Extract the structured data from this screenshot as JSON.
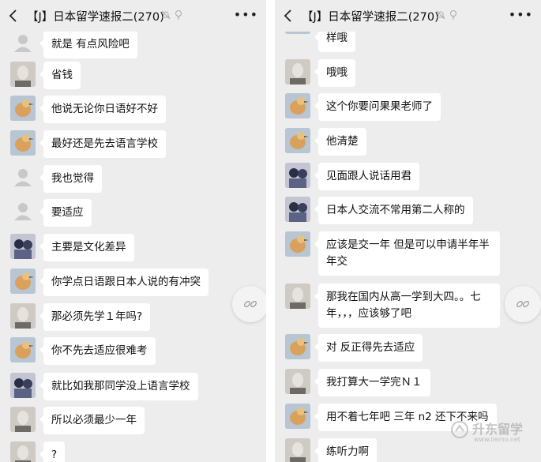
{
  "left": {
    "header": {
      "title": "【J】日本留学速报二(270)"
    },
    "messages": [
      {
        "avatar": "default-avatar",
        "text": "就是 有点风险吧"
      },
      {
        "avatar": "face-avatar",
        "text": "省钱"
      },
      {
        "avatar": "bird-avatar",
        "text": "他说无论你日语好不好"
      },
      {
        "avatar": "bird-avatar",
        "text": "最好还是先去语言学校"
      },
      {
        "avatar": "default-avatar",
        "text": "我也觉得"
      },
      {
        "avatar": "default-avatar",
        "text": "要适应"
      },
      {
        "avatar": "girl-avatar",
        "text": "主要是文化差异"
      },
      {
        "avatar": "bird-avatar",
        "text": "你学点日语跟日本人说的有冲突"
      },
      {
        "avatar": "face-avatar",
        "text": "那必须先学１年吗?"
      },
      {
        "avatar": "bird-avatar",
        "text": "你不先去适应很难考"
      },
      {
        "avatar": "girl-avatar",
        "text": "就比如我那同学没上语言学校"
      },
      {
        "avatar": "face-avatar",
        "text": "所以必须最少一年"
      },
      {
        "avatar": "face-avatar",
        "text": "?"
      }
    ]
  },
  "right": {
    "header": {
      "title": "【J】日本留学速报二(270)"
    },
    "messages": [
      {
        "avatar": "bird-avatar",
        "text": "样哦"
      },
      {
        "avatar": "face-avatar",
        "text": "哦哦"
      },
      {
        "avatar": "bird-avatar",
        "text": "这个你要问果果老师了"
      },
      {
        "avatar": "bird-avatar",
        "text": "他清楚"
      },
      {
        "avatar": "girl-avatar",
        "text": "见面跟人说话用君"
      },
      {
        "avatar": "girl-avatar",
        "text": "日本人交流不常用第二人称的"
      },
      {
        "avatar": "bird-avatar",
        "text": "应该是交一年 但是可以申请半年半年交"
      },
      {
        "avatar": "face-avatar",
        "text": "那我在国内从高一学到大四。。七年，，，应该够了吧"
      },
      {
        "avatar": "bird-avatar",
        "text": "对 反正得先去适应"
      },
      {
        "avatar": "face-avatar",
        "text": "我打算大一学完Ｎ１"
      },
      {
        "avatar": "bird-avatar",
        "text": "用不着七年吧  三年 n2 还下不来吗"
      },
      {
        "avatar": "face-avatar",
        "text": "练听力啊"
      }
    ]
  },
  "watermark": {
    "brand": "升东留学",
    "url": "www.liemo.net"
  }
}
